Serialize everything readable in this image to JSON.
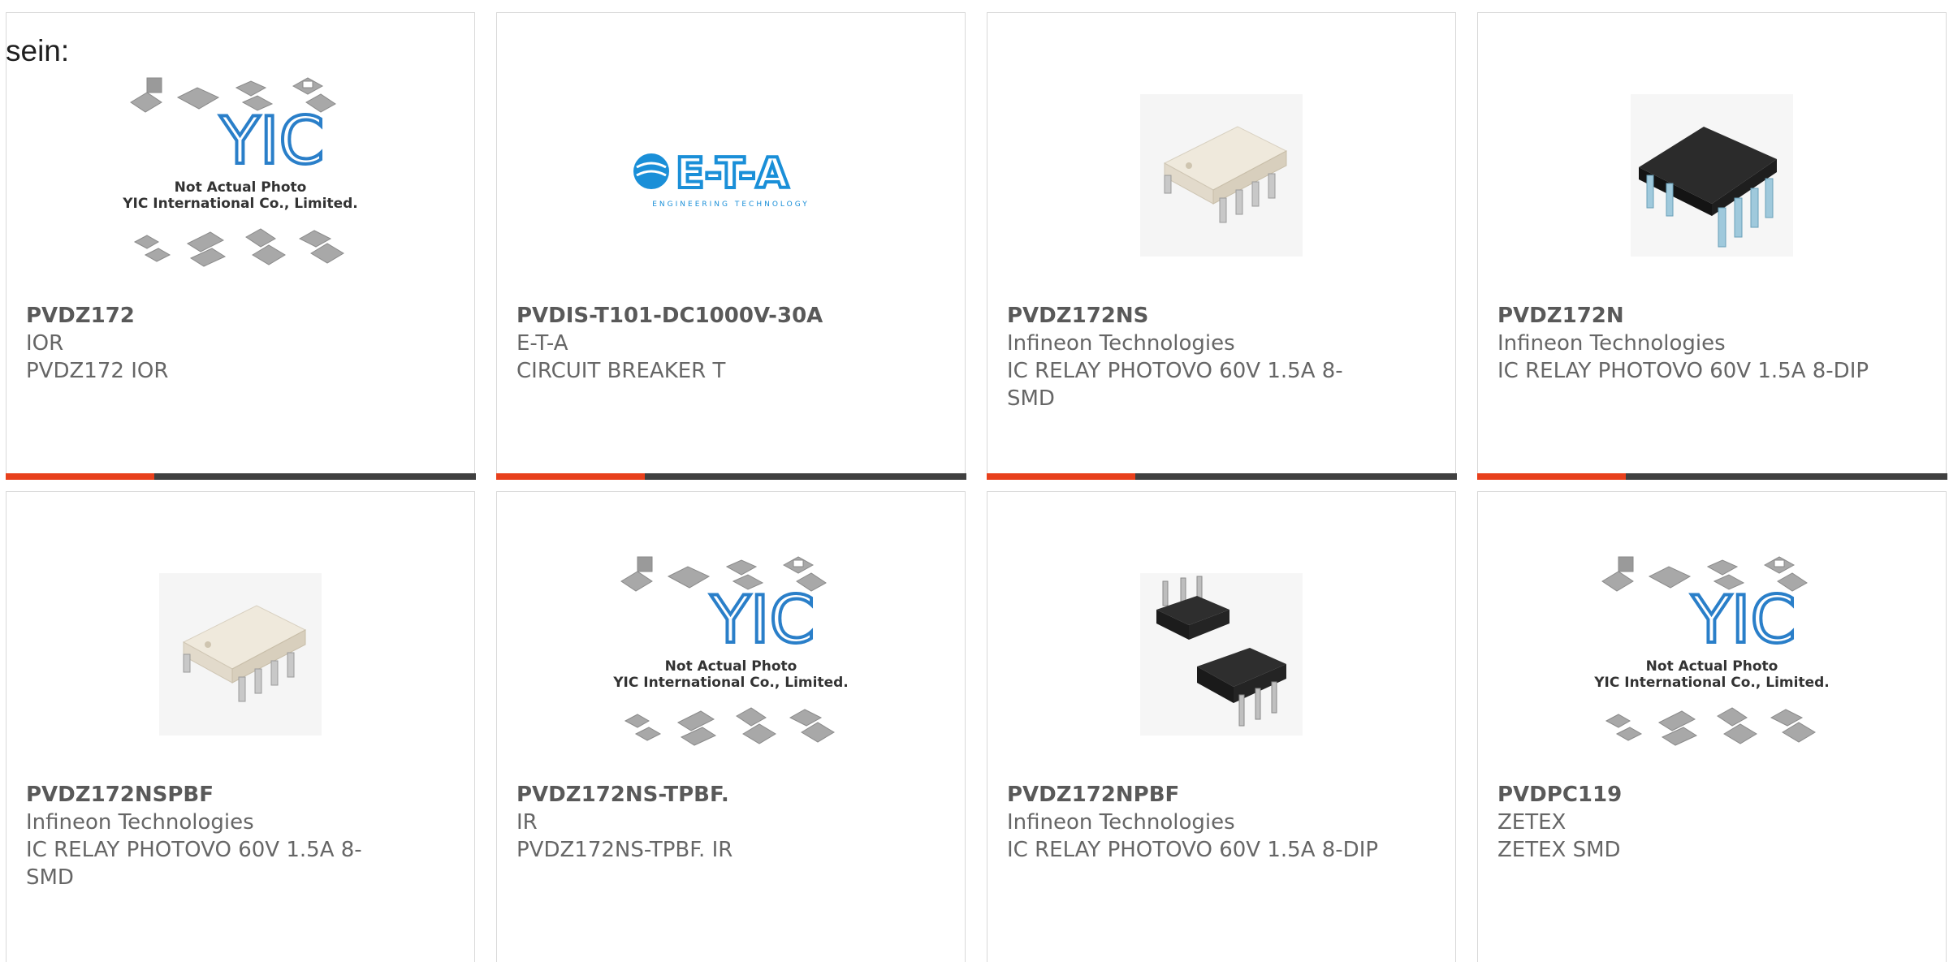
{
  "lead_text": "sein:",
  "colors": {
    "accent": "#e8401c",
    "bar_dark": "#404040",
    "border": "#d9d9d9",
    "text": "#666666"
  },
  "products": [
    {
      "name": "PVDZ172",
      "manufacturer": "IOR",
      "description": "PVDZ172 IOR",
      "image": "yic-placeholder",
      "caption1": "Not Actual Photo",
      "caption2": "YIC International Co., Limited.",
      "logo": "YIC"
    },
    {
      "name": "PVDIS-T101-DC1000V-30A",
      "manufacturer": "E-T-A",
      "description": "CIRCUIT BREAKER T",
      "image": "eta-logo",
      "logo_text": "E-T-A",
      "logo_sub": "ENGINEERING TECHNOLOGY"
    },
    {
      "name": "PVDZ172NS",
      "manufacturer": "Infineon Technologies",
      "description": "IC RELAY PHOTOVO 60V 1.5A 8-SMD",
      "image": "smd-chip-white"
    },
    {
      "name": "PVDZ172N",
      "manufacturer": "Infineon Technologies",
      "description": "IC RELAY PHOTOVO 60V 1.5A 8-DIP",
      "image": "dip-chip-black"
    },
    {
      "name": "PVDZ172NSPBF",
      "manufacturer": "Infineon Technologies",
      "description": "IC RELAY PHOTOVO 60V 1.5A 8-SMD",
      "image": "smd-chip-white"
    },
    {
      "name": "PVDZ172NS-TPBF.",
      "manufacturer": "IR",
      "description": "PVDZ172NS-TPBF. IR",
      "image": "yic-placeholder",
      "caption1": "Not Actual Photo",
      "caption2": "YIC International Co., Limited.",
      "logo": "YIC"
    },
    {
      "name": "PVDZ172NPBF",
      "manufacturer": "Infineon Technologies",
      "description": "IC RELAY PHOTOVO 60V 1.5A 8-DIP",
      "image": "dip-chip-pair"
    },
    {
      "name": "PVDPC119",
      "manufacturer": "ZETEX",
      "description": "ZETEX SMD",
      "image": "yic-placeholder",
      "caption1": "Not Actual Photo",
      "caption2": "YIC International Co., Limited.",
      "logo": "YIC"
    }
  ]
}
